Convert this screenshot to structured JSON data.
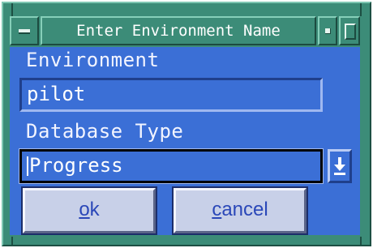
{
  "window": {
    "title": "Enter Environment Name"
  },
  "form": {
    "environment_label": "Environment",
    "environment_value": "pilot",
    "database_type_label": "Database Type",
    "database_type_value": "Progress"
  },
  "buttons": {
    "ok_mnemonic": "o",
    "ok_rest": "k",
    "cancel_mnemonic": "c",
    "cancel_rest": "ancel"
  },
  "icons": {
    "window_menu": "window-menu-icon",
    "minimize": "minimize-icon",
    "maximize": "maximize-icon",
    "dropdown": "down-arrow-icon"
  },
  "colors": {
    "frame": "#3c8c78",
    "client": "#3b6fd6",
    "button_face": "#c8d0e8",
    "button_text": "#2a47b8",
    "text": "#ffffff"
  }
}
